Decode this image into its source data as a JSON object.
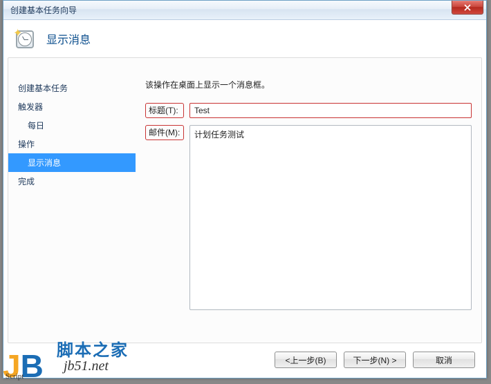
{
  "window": {
    "title": "创建基本任务向导"
  },
  "header": {
    "title": "显示消息"
  },
  "sidebar": {
    "items": [
      {
        "label": "创建基本任务",
        "indent": false,
        "selected": false
      },
      {
        "label": "触发器",
        "indent": false,
        "selected": false
      },
      {
        "label": "每日",
        "indent": true,
        "selected": false
      },
      {
        "label": "操作",
        "indent": false,
        "selected": false
      },
      {
        "label": "显示消息",
        "indent": true,
        "selected": true
      },
      {
        "label": "完成",
        "indent": false,
        "selected": false
      }
    ]
  },
  "main": {
    "description": "该操作在桌面上显示一个消息框。",
    "title_label": "标题(T):",
    "title_value": "Test",
    "message_label": "邮件(M):",
    "message_value": "计划任务测试"
  },
  "buttons": {
    "back": "<上一步(B)",
    "next": "下一步(N) >",
    "cancel": "取消"
  },
  "watermark": {
    "brand": "脚本之家",
    "url": "jb51.net",
    "tag": "Script"
  }
}
